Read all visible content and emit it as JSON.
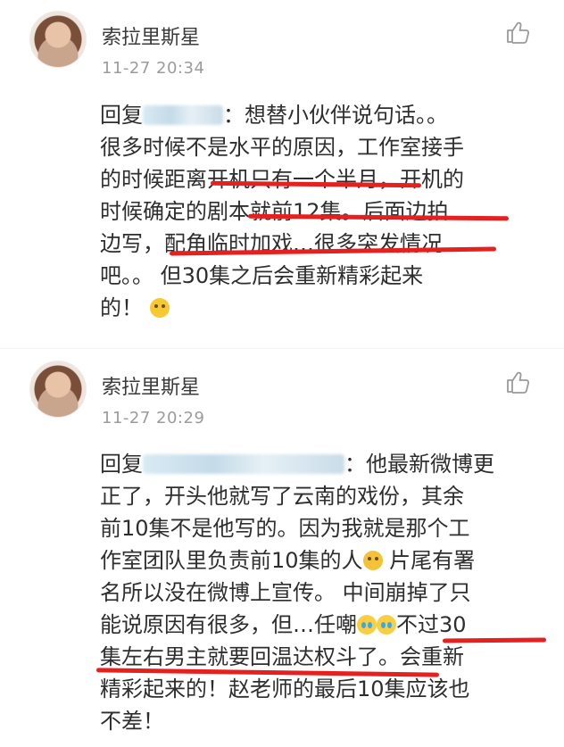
{
  "comments": [
    {
      "author": "索拉里斯星",
      "time": "11-27  20:34",
      "lines": [
        {
          "pre": "回复",
          "post": "：想替小伙伴说句话。。"
        },
        {
          "text": "很多时候不是水平的原因，工作室接手"
        },
        {
          "text": "的时候距离开机只有一个半月，开机的"
        },
        {
          "text": "时候确定的剧本就前12集。后面边拍"
        },
        {
          "text": "边写，配角临时加戏…很多突发情况"
        },
        {
          "text": "吧。。    但30集之后会重新精彩起来"
        },
        {
          "text": "的！"
        }
      ]
    },
    {
      "author": "索拉里斯星",
      "time": "11-27  20:29",
      "lines": [
        {
          "pre": "回复",
          "post": "：他最新微博更"
        },
        {
          "text": "正了，开头他就写了云南的戏份，其余"
        },
        {
          "text": "前10集不是他写的。因为我就是那个工"
        },
        {
          "text": "作室团队里负责前10集的人"
        },
        {
          "text": "名所以没在微博上宣传。  中间崩掉了只"
        },
        {
          "text": "能说原因有很多，但…任嘲"
        },
        {
          "text": "集左右男主就要回温达权斗了。会重新"
        },
        {
          "text": "精彩起来的！赵老师的最后10集应该也"
        },
        {
          "text": "不差！"
        }
      ],
      "line4_tail": " 片尾有署",
      "line6_tail": "不过30"
    }
  ],
  "colors": {
    "underline": "#e61f1f",
    "time": "#9b9b9b",
    "text": "#2e2e2e"
  },
  "icons": {
    "like": "thumbs-up-icon",
    "emoji_grin": "grimace-emoji",
    "emoji_tongue": "wink-tongue-emoji",
    "emoji_cry": "laugh-cry-emoji"
  }
}
